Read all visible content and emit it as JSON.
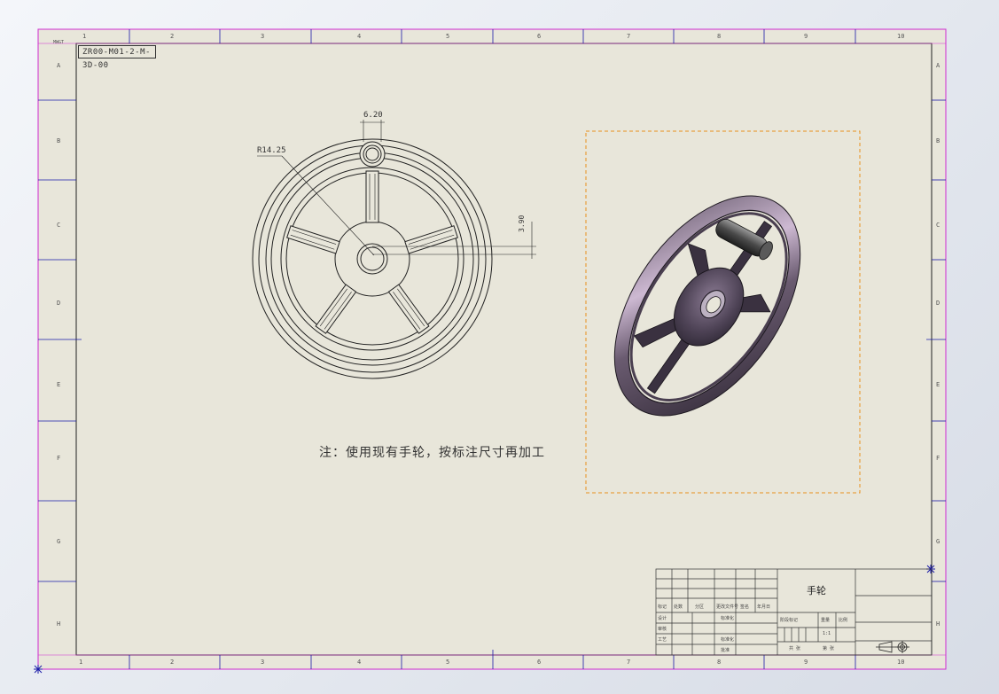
{
  "drawing": {
    "drawing_number": "ZR00-M01-2-M-3D-00",
    "note": "注：使用现有手轮，按标注尺寸再加工",
    "dimensions": {
      "spoke_width": "6.20",
      "radius": "R14.25",
      "offset": "3.90"
    },
    "corner_label": "MWGT"
  },
  "sheet": {
    "zone_columns": [
      "1",
      "2",
      "3",
      "4",
      "5",
      "6",
      "7",
      "8",
      "9",
      "10"
    ],
    "zone_rows": [
      "A",
      "B",
      "C",
      "D",
      "E",
      "F",
      "G",
      "H"
    ]
  },
  "title_block": {
    "part_name": "手轮",
    "labels": {
      "mark": "标记",
      "count": "处数",
      "zone": "分区",
      "change_doc": "更改文件号",
      "sign": "签名",
      "date": "年月日",
      "design": "设计",
      "check": "审核",
      "process": "工艺",
      "standard": "标准化",
      "approve": "批准",
      "std_check": "标准化",
      "stage_mark": "阶段标记",
      "weight": "重量",
      "scale": "比例",
      "scale_value": "1:1",
      "sheets_total": "共 张",
      "sheet_no": "第 张"
    }
  }
}
